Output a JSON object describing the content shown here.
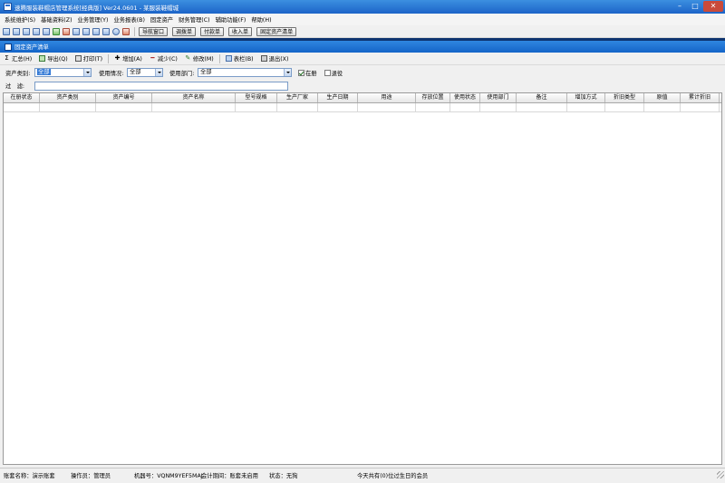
{
  "window": {
    "title": "速腾服装鞋帽店管理系统[经典版] Ver24.0601 - 某服装鞋帽城"
  },
  "menu": [
    "系统维护(S)",
    "基础资料(Z)",
    "业务管理(Y)",
    "业务报表(B)",
    "固定资产",
    "财务管理(C)",
    "辅助功能(F)",
    "帮助(H)"
  ],
  "quick_buttons": [
    "导航窗口",
    "调拨单",
    "付款单",
    "收入单",
    "固定资产清单"
  ],
  "doc_tab": "固定资产清单",
  "actions": {
    "summary": "汇总(H)",
    "export": "导出(Q)",
    "print": "打印(T)",
    "add": "增加(A)",
    "reduce": "减少(C)",
    "edit": "修改(M)",
    "columns": "表栏(B)",
    "exit": "退出(X)"
  },
  "filters": {
    "category_label": "资产类别:",
    "category_value": "全部",
    "usage_label": "使用情况:",
    "usage_value": "全部",
    "dept_label": "使用部门:",
    "dept_value": "全部",
    "in_book_label": "在册",
    "retired_label": "退役",
    "filter_label": "过　滤:"
  },
  "table": {
    "columns": [
      "在册状态",
      "资产类别",
      "资产编号",
      "资产名称",
      "型号规格",
      "生产厂家",
      "生产日期",
      "用途",
      "存放位置",
      "使用状态",
      "使用部门",
      "备注",
      "增加方式",
      "折旧类型",
      "原值",
      "累计折旧"
    ]
  },
  "status": {
    "account": "账套名称：演示账套",
    "operator": "操作员：管理员",
    "machine": "机器号：VQNM9YEF5MAJ",
    "period": "会计期间：账套未启用",
    "state": "状态：无狗",
    "birthday": "今天共有(0)位过生日的会员"
  },
  "icons": [
    "app-icon",
    "minimize-icon",
    "maximize-icon",
    "close-icon"
  ],
  "colors": {
    "title_bar": "#1c64c8",
    "doc_bar": "#1464c8",
    "dark_strip": "#0e3470"
  }
}
